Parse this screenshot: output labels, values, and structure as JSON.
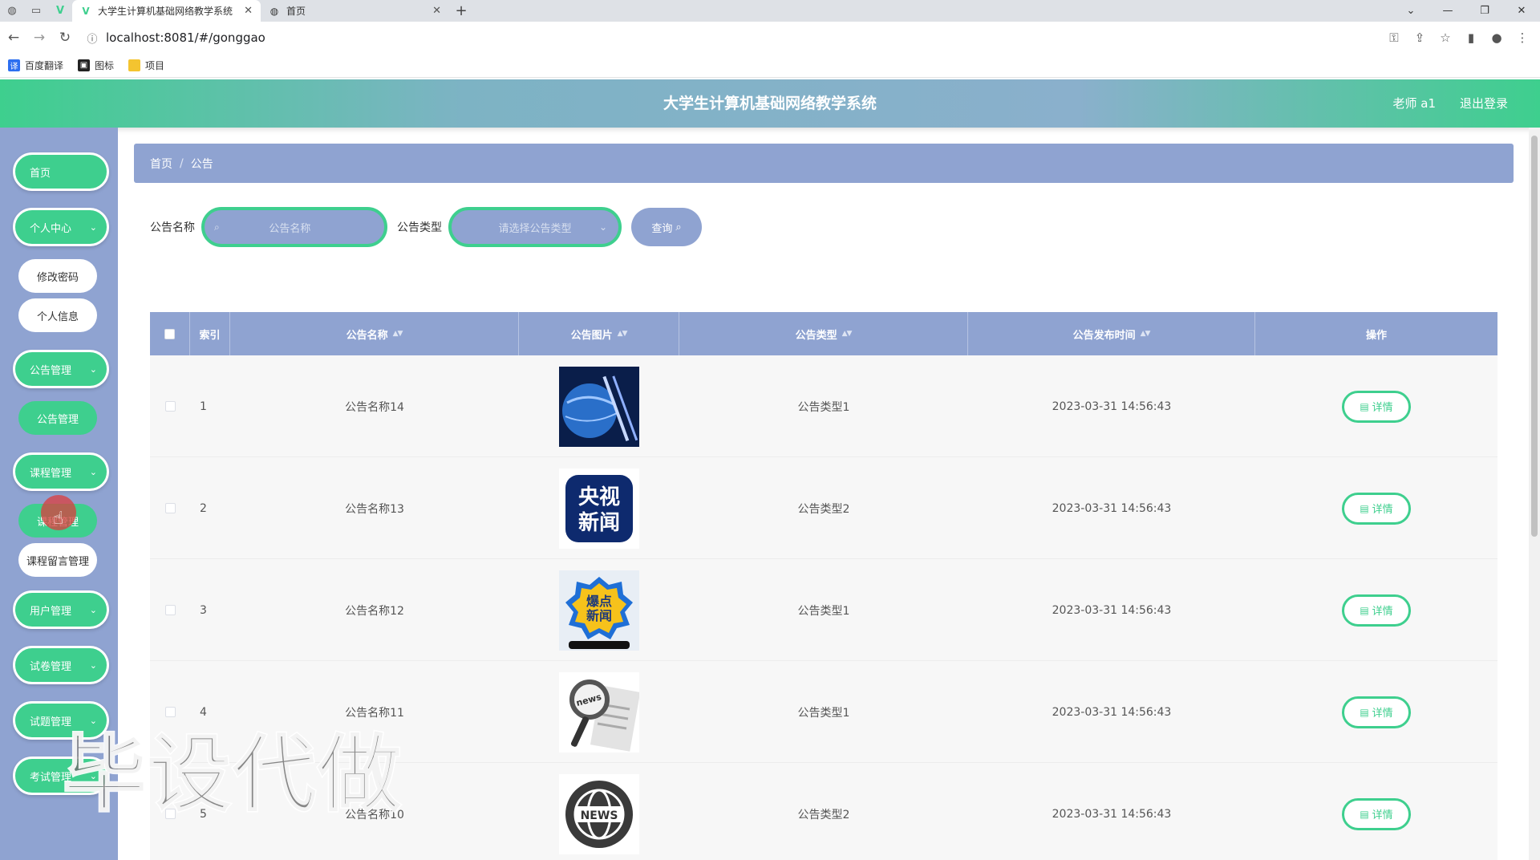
{
  "browser": {
    "tabs": [
      {
        "title": "大学生计算机基础网络教学系统",
        "active": true
      },
      {
        "title": "首页",
        "active": false
      }
    ],
    "url": "localhost:8081/#/gonggao",
    "bookmarks": [
      "百度翻译",
      "图标",
      "项目"
    ]
  },
  "header": {
    "title": "大学生计算机基础网络教学系统",
    "user": "老师 a1",
    "logout": "退出登录"
  },
  "sidebar": {
    "home": "首页",
    "personal": "个人中心",
    "change_password": "修改密码",
    "personal_info": "个人信息",
    "notice_mgmt": "公告管理",
    "notice_mgmt_sub": "公告管理",
    "course_mgmt": "课程管理",
    "course_mgmt_sub": "课程管理",
    "course_comment_mgmt": "课程留言管理",
    "user_mgmt": "用户管理",
    "paper_mgmt": "试卷管理",
    "question_mgmt": "试题管理",
    "exam_mgmt": "考试管理"
  },
  "breadcrumb": {
    "home": "首页",
    "current": "公告"
  },
  "search": {
    "name_label": "公告名称",
    "name_placeholder": "公告名称",
    "type_label": "公告类型",
    "type_placeholder": "请选择公告类型",
    "query_button": "查询"
  },
  "table": {
    "headers": {
      "index": "索引",
      "name": "公告名称",
      "image": "公告图片",
      "type": "公告类型",
      "time": "公告发布时间",
      "ops": "操作"
    },
    "detail_label": "详情",
    "rows": [
      {
        "index": "1",
        "name": "公告名称14",
        "type": "公告类型1",
        "time": "2023-03-31 14:56:43"
      },
      {
        "index": "2",
        "name": "公告名称13",
        "type": "公告类型2",
        "time": "2023-03-31 14:56:43",
        "img_text_top": "央视",
        "img_text_bottom": "新闻"
      },
      {
        "index": "3",
        "name": "公告名称12",
        "type": "公告类型1",
        "time": "2023-03-31 14:56:43",
        "img_text_top": "爆点",
        "img_text_bottom": "新闻"
      },
      {
        "index": "4",
        "name": "公告名称11",
        "type": "公告类型1",
        "time": "2023-03-31 14:56:43",
        "img_text_top": "news"
      },
      {
        "index": "5",
        "name": "公告名称10",
        "type": "公告类型2",
        "time": "2023-03-31 14:56:43",
        "img_text_top": "NEWS"
      }
    ]
  },
  "watermark": "毕设代做"
}
